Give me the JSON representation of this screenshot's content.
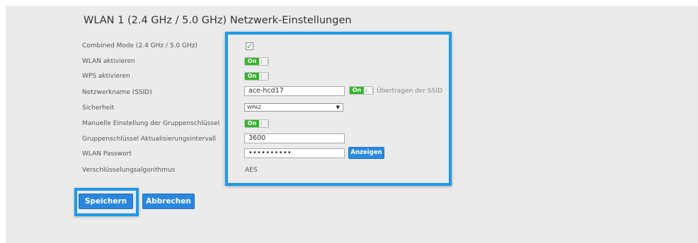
{
  "page": {
    "title": "WLAN 1 (2.4 GHz / 5.0 GHz) Netzwerk-Einstellungen"
  },
  "fields": {
    "combined_mode_label": "Combined Mode (2.4 GHz / 5.0 GHz)",
    "wlan_enable_label": "WLAN aktivieren",
    "wps_enable_label": "WPS aktivieren",
    "ssid_label": "Netzwerkname (SSID)",
    "security_label": "Sicherheit",
    "group_key_manual_label": "Manuelle Einstellung der Gruppenschlüssel",
    "group_key_interval_label": "Gruppenschlüssel Aktualisierungsintervall",
    "wlan_password_label": "WLAN Passwort",
    "encryption_label": "Verschlüsselungsalgorithmus"
  },
  "values": {
    "combined_mode_checked": "✓",
    "toggle_on_text": "On",
    "ssid_value": "ace-hcd17",
    "broadcast_ssid_label": "Übertragen der SSID",
    "security_value": "WPA2",
    "group_key_interval_value": "3600",
    "password_masked": "••••••••••",
    "show_password_label": "Anzeigen",
    "encryption_value": "AES"
  },
  "actions": {
    "save_label": "Speichern",
    "cancel_label": "Abbrechen"
  },
  "colors": {
    "accent": "#1f9ae8",
    "toggle_on": "#35b52b",
    "button": "#2b87dd"
  }
}
